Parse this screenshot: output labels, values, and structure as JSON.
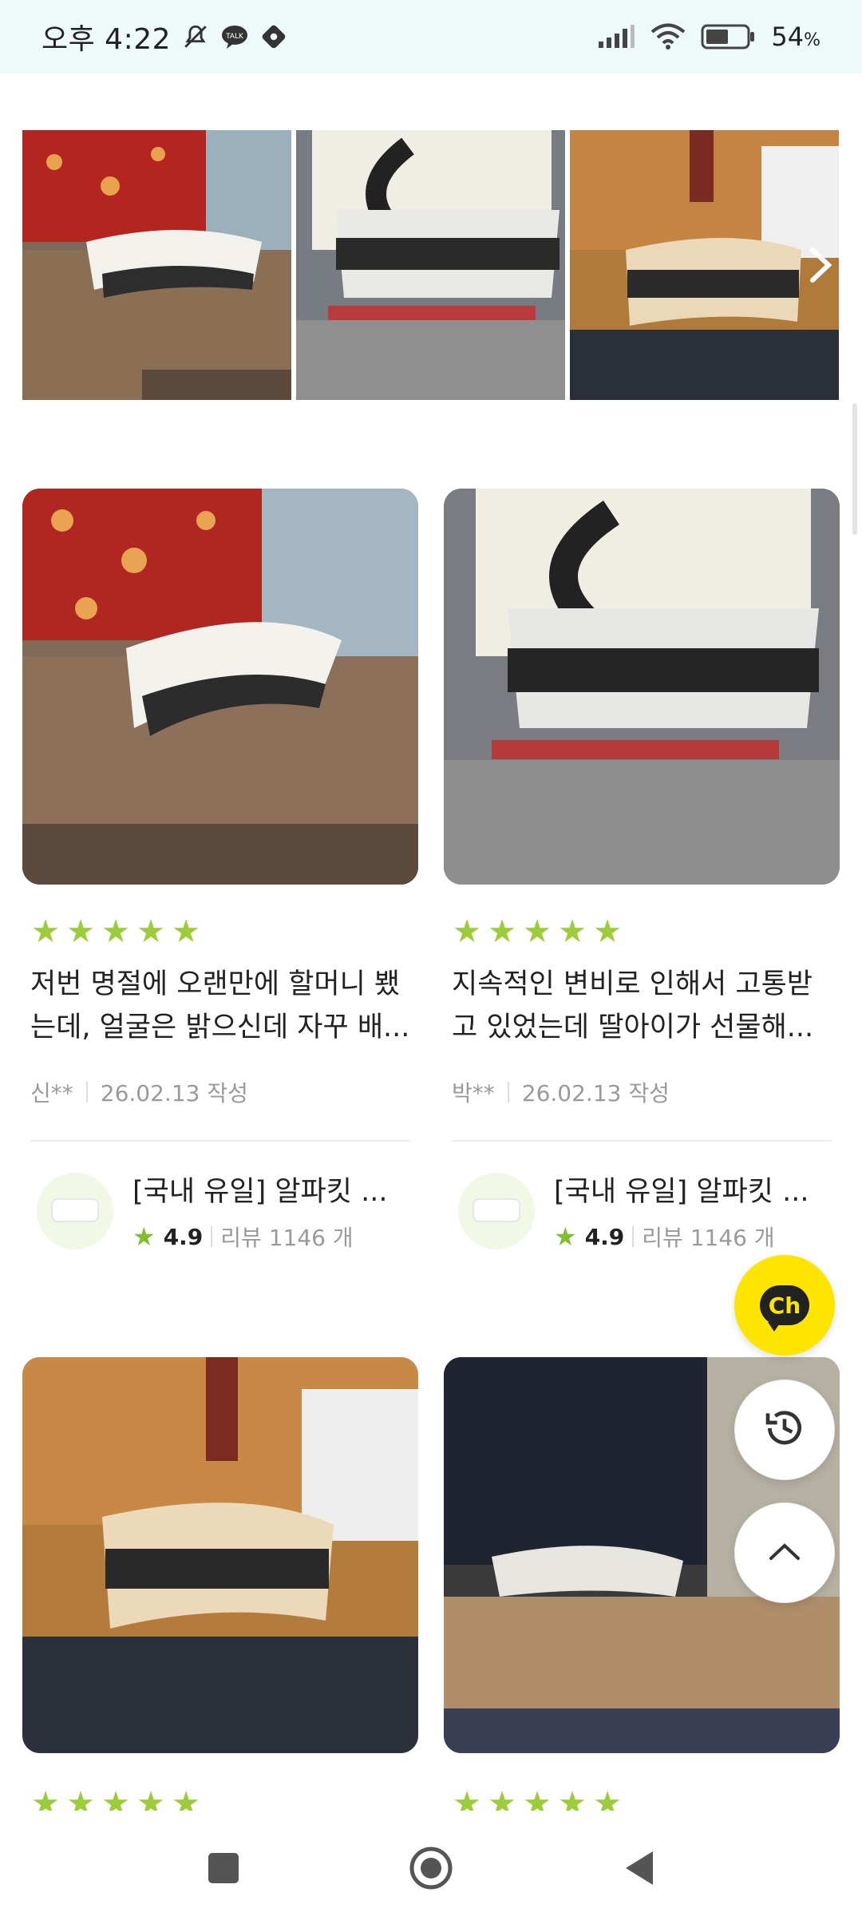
{
  "status_bar": {
    "time": "오후 4:22",
    "battery": "54",
    "battery_unit": "%",
    "icons": [
      "mute-icon",
      "talk-icon",
      "game-icon",
      "signal-icon",
      "wifi-icon",
      "battery-icon"
    ]
  },
  "reviews": [
    {
      "rating": 5,
      "text": "저번 명절에 오랜만에 할머니 뵀는데, 얼굴은 밝으신데 자꾸 배...",
      "author": "신**",
      "date": "26.02.13 작성",
      "product_name": "[국내 유일] 알파킷 ...",
      "product_rating": "4.9",
      "product_reviews": "리뷰 1146 개"
    },
    {
      "rating": 5,
      "text": "지속적인 변비로 인해서 고통받고 있었는데 딸아이가 선물해...",
      "author": "박**",
      "date": "26.02.13 작성",
      "product_name": "[국내 유일] 알파킷 ...",
      "product_rating": "4.9",
      "product_reviews": "리뷰 1146 개"
    }
  ],
  "floating": {
    "chat_label": "Ch"
  },
  "colors": {
    "status_bg": "#eefaf9",
    "star": "#9ccc3a",
    "chat_yellow": "#fee500"
  }
}
